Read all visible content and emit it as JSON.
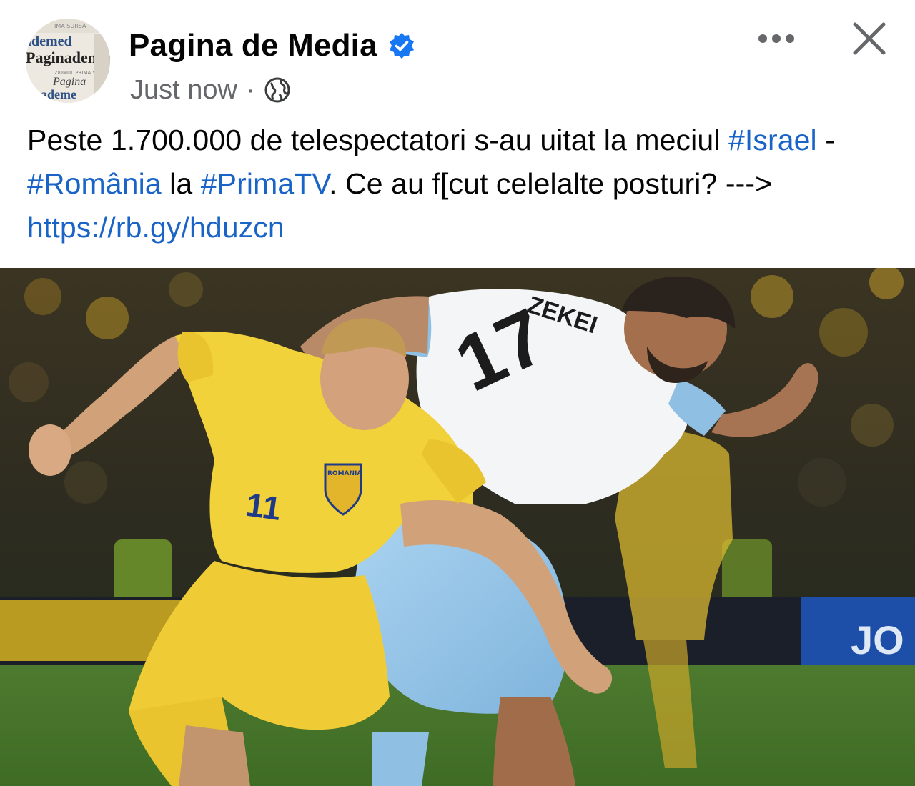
{
  "header": {
    "page_name": "Pagina de Media",
    "verified": true,
    "timestamp": "Just now",
    "separator": "·",
    "audience_icon": "globe-icon",
    "more_icon": "more-horizontal-icon",
    "close_icon": "close-icon"
  },
  "post": {
    "text_part1": "Peste 1.700.000 de telespectatori s-au uitat la meciul ",
    "hashtag1": "#Israel",
    "text_part2": " - ",
    "hashtag2": "#România",
    "text_part3": " la ",
    "hashtag3": "#PrimaTV",
    "text_part4": ". Ce au f[cut celelalte posturi? ---> ",
    "link": "https://rb.gy/hduzcn"
  },
  "photo": {
    "description_icon": "football-match-photo",
    "yellow_player_number": "11",
    "white_player_number": "17",
    "white_player_name": "ZEKEI",
    "yellow_badge_text": "ROMANIA",
    "board_text": "JO"
  },
  "colors": {
    "link": "#1a64c8",
    "verified": "#1877f2",
    "meta_gray": "#65676b",
    "romania_yellow": "#f2d23a",
    "israel_white": "#f4f5f7",
    "israel_lightblue": "#8fbfe3"
  }
}
